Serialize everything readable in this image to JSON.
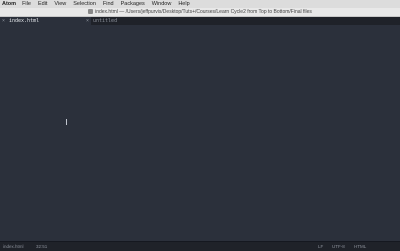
{
  "menubar": {
    "app": "Atom",
    "items": [
      "File",
      "Edit",
      "View",
      "Selection",
      "Find",
      "Packages",
      "Window",
      "Help"
    ]
  },
  "window": {
    "title": "index.html — /Users/jeffpurvis/Desktop/Tuts+/Courses/Learn Cycle2 from Top to Bottom/Final files"
  },
  "tabs": [
    {
      "label": "index.html",
      "active": true
    },
    {
      "label": "untitled",
      "active": false
    }
  ],
  "status": {
    "file": "index.html",
    "position": "32:51",
    "line_ending": "LF",
    "encoding": "UTF-8",
    "grammar": "HTML"
  }
}
